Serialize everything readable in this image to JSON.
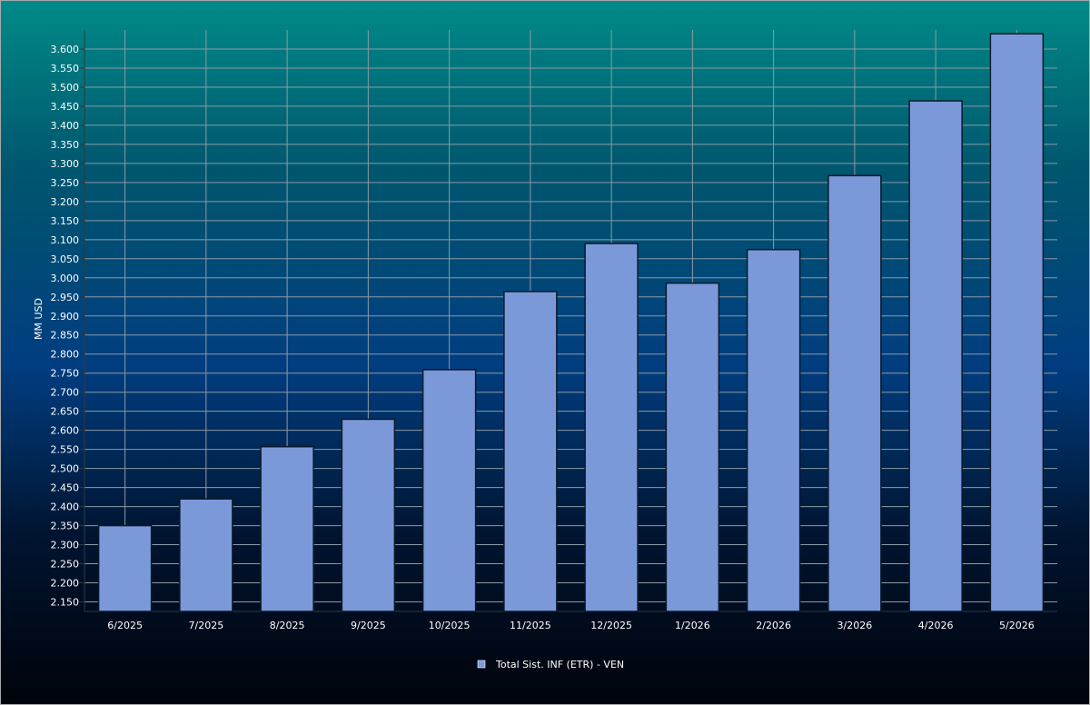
{
  "chart_data": {
    "type": "bar",
    "categories": [
      "6/2025",
      "7/2025",
      "8/2025",
      "9/2025",
      "10/2025",
      "11/2025",
      "12/2025",
      "1/2026",
      "2/2026",
      "3/2026",
      "4/2026",
      "5/2026"
    ],
    "series": [
      {
        "name": "Total Sist. INF (ETR) - VEN",
        "values": [
          2350,
          2420,
          2557,
          2629,
          2759,
          2964,
          3090,
          2986,
          3074,
          3268,
          3464,
          3640
        ],
        "color": "#7b99d9"
      }
    ],
    "ylabel": "MM USD",
    "xlabel": "",
    "ylim": [
      2125,
      3650
    ],
    "yticks": [
      2150,
      2200,
      2250,
      2300,
      2350,
      2400,
      2450,
      2500,
      2550,
      2600,
      2650,
      2700,
      2750,
      2800,
      2850,
      2900,
      2950,
      3000,
      3050,
      3100,
      3150,
      3200,
      3250,
      3300,
      3350,
      3400,
      3450,
      3500,
      3550,
      3600
    ],
    "ytick_labels": [
      "2.150",
      "2.200",
      "2.250",
      "2.300",
      "2.350",
      "2.400",
      "2.450",
      "2.500",
      "2.550",
      "2.600",
      "2.650",
      "2.700",
      "2.750",
      "2.800",
      "2.850",
      "2.900",
      "2.950",
      "3.000",
      "3.050",
      "3.100",
      "3.150",
      "3.200",
      "3.250",
      "3.300",
      "3.350",
      "3.400",
      "3.450",
      "3.500",
      "3.550",
      "3.600"
    ],
    "grid": true,
    "legend": "bottom-center",
    "colors": {
      "bar_fill": "#7b99d9",
      "bar_stroke": "#0a1a2a",
      "grid": "#8c9aa4",
      "text": "#ffffff"
    }
  }
}
